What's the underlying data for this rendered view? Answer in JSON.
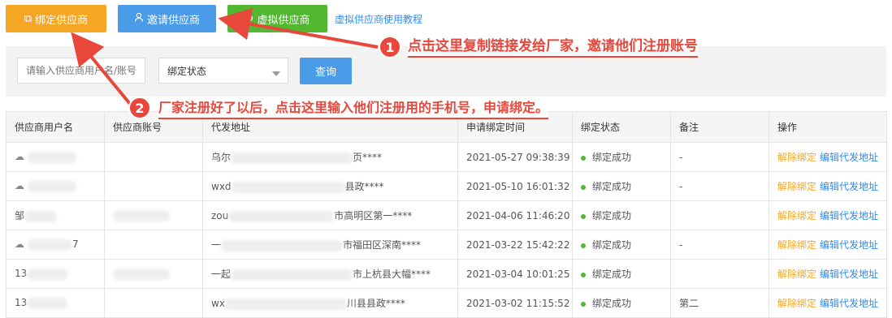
{
  "toolbar": {
    "bind_label": "绑定供应商",
    "invite_label": "邀请供应商",
    "virtual_label": "虚拟供应商",
    "tutorial_link": "虚拟供应商使用教程"
  },
  "filter": {
    "search_placeholder": "请输入供应商用户名/账号",
    "status_value": "绑定状态",
    "query_label": "查询"
  },
  "table": {
    "headers": [
      "供应商用户名",
      "供应商账号",
      "代发地址",
      "申请绑定时间",
      "绑定状态",
      "备注",
      "操作"
    ],
    "rows": [
      {
        "username": "",
        "account": "",
        "address_head": "乌尔",
        "address_tail": "页****",
        "time": "2021-05-27 09:38:39",
        "status": "绑定成功",
        "note": "-"
      },
      {
        "username": "",
        "account": "",
        "address_head": "wxd",
        "address_tail": "县政****",
        "time": "2021-05-10 16:01:32",
        "status": "绑定成功",
        "note": "-"
      },
      {
        "username": "邹",
        "account": "",
        "address_head": "zou",
        "address_tail": "市高明区第一****",
        "time": "2021-04-06 11:46:20",
        "status": "绑定成功",
        "note": ""
      },
      {
        "username": "7",
        "account": "",
        "address_head": "一",
        "address_tail": "市福田区深南****",
        "time": "2021-03-22 15:42:22",
        "status": "绑定成功",
        "note": "-"
      },
      {
        "username": "13",
        "account": "",
        "address_head": "一起",
        "address_tail": "市上杭县大幅****",
        "time": "2021-03-04 10:01:25",
        "status": "绑定成功",
        "note": ""
      },
      {
        "username": "13",
        "account": "",
        "address_head": "wx",
        "address_tail": "川县县政****",
        "time": "2021-03-02 11:15:52",
        "status": "绑定成功",
        "note": "第二"
      }
    ],
    "op_unbind": "解除绑定",
    "op_edit": "编辑代发地址"
  },
  "annotations": {
    "one_number": "1",
    "one_text": "点击这里复制链接发给厂家，邀请他们注册账号",
    "two_number": "2",
    "two_text": "厂家注册好了以后，点击这里输入他们注册用的手机号，申请绑定。",
    "color": "#e8473c"
  }
}
